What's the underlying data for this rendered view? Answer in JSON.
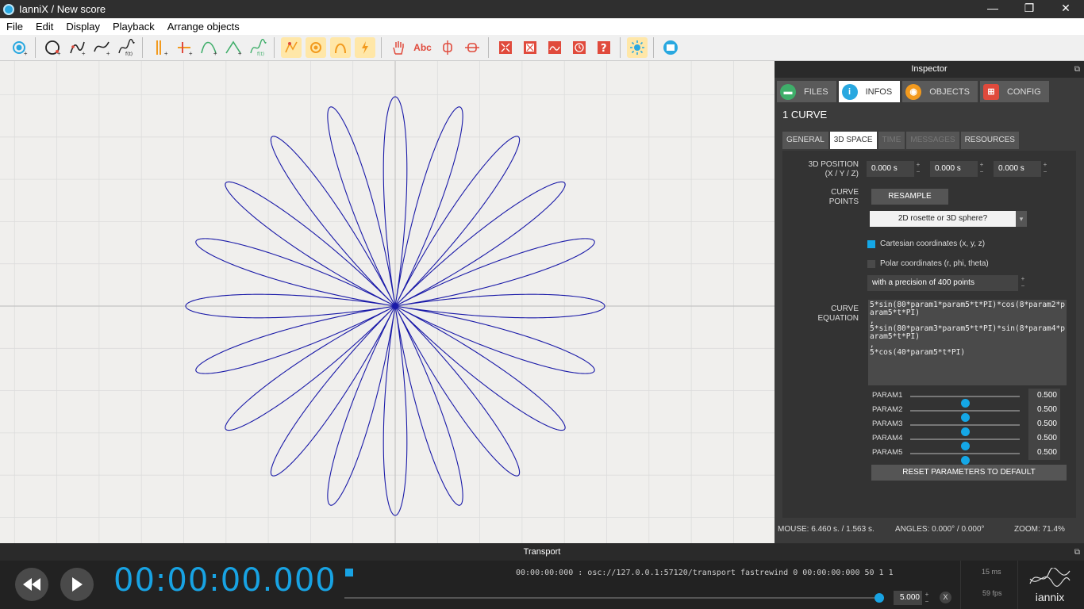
{
  "window": {
    "title": "IanniX / New score",
    "minimize": "—",
    "restore": "❐",
    "close": "✕"
  },
  "menu": [
    "File",
    "Edit",
    "Display",
    "Playback",
    "Arrange objects"
  ],
  "toolbar": {
    "tools": [
      "add-point-icon",
      "add-circle-icon",
      "add-curve-icon",
      "add-smooth-curve-icon",
      "add-equation-curve-icon",
      "add-trigger-cursor-icon",
      "add-trigger-icon",
      "add-bezier-icon",
      "add-line-icon",
      "add-function-icon",
      "snap-grid-icon",
      "snap-objects-icon",
      "magnet-icon",
      "lightning-icon",
      "hand-icon",
      "text-icon",
      "unlink-icon",
      "link-icon",
      "fullscreen-icon",
      "preview-icon",
      "render-icon",
      "clock-icon",
      "help-icon",
      "brightness-icon",
      "folder-icon"
    ],
    "text_tool_label": "Abc"
  },
  "inspector": {
    "title": "Inspector",
    "tabs": [
      {
        "label": "FILES",
        "color": "#3fae6a"
      },
      {
        "label": "INFOS",
        "color": "#29a8e0"
      },
      {
        "label": "OBJECTS",
        "color": "#f29a1e"
      },
      {
        "label": "CONFIG",
        "color": "#e04a3c"
      }
    ],
    "active_tab": "INFOS",
    "object_title": "1 CURVE",
    "subtabs": [
      "GENERAL",
      "3D SPACE",
      "TIME",
      "MESSAGES",
      "RESOURCES"
    ],
    "active_subtab": "3D SPACE",
    "position_label_1": "3D POSITION",
    "position_label_2": "(X / Y / Z)",
    "position": [
      "0.000 s",
      "0.000 s",
      "0.000 s"
    ],
    "curve_points_label_1": "CURVE",
    "curve_points_label_2": "POINTS",
    "resample_label": "RESAMPLE",
    "preset_value": "2D rosette or 3D sphere?",
    "cartesian_label": "Cartesian coordinates (x, y, z)",
    "cartesian_checked": true,
    "polar_label": "Polar coordinates (r, phi, theta)",
    "polar_checked": false,
    "precision_label": "with a precision of 400 points",
    "curve_equation_label_1": "CURVE",
    "curve_equation_label_2": "EQUATION",
    "equation": "5*sin(80*param1*param5*t*PI)*cos(8*param2*param5*t*PI)\n,\n5*sin(80*param3*param5*t*PI)*sin(8*param4*param5*t*PI)\n,\n5*cos(40*param5*t*PI)",
    "params": [
      {
        "name": "PARAM1",
        "value": "0.500",
        "level": 0.5
      },
      {
        "name": "PARAM2",
        "value": "0.500",
        "level": 0.5
      },
      {
        "name": "PARAM3",
        "value": "0.500",
        "level": 0.5
      },
      {
        "name": "PARAM4",
        "value": "0.500",
        "level": 0.5
      },
      {
        "name": "PARAM5",
        "value": "0.500",
        "level": 0.5
      }
    ],
    "reset_label": "RESET PARAMETERS TO DEFAULT",
    "status_mouse": "MOUSE: 6.460 s. / 1.563 s.",
    "status_angles": "ANGLES: 0.000° / 0.000°",
    "status_zoom": "ZOOM: 71.4%"
  },
  "transport": {
    "title": "Transport",
    "time": "00:00:00.000",
    "osc_message": "00:00:00:000 : osc://127.0.0.1:57120/transport fastrewind 0 00:00:00:000 50 1 1",
    "speed": "5.000",
    "latency": "15 ms",
    "fps": "59 fps",
    "clear_label": "X",
    "brand": "iannix"
  },
  "colors": {
    "accent": "#18a3e3",
    "curve": "#1a1aa8",
    "grid": "#dcdcdc"
  }
}
